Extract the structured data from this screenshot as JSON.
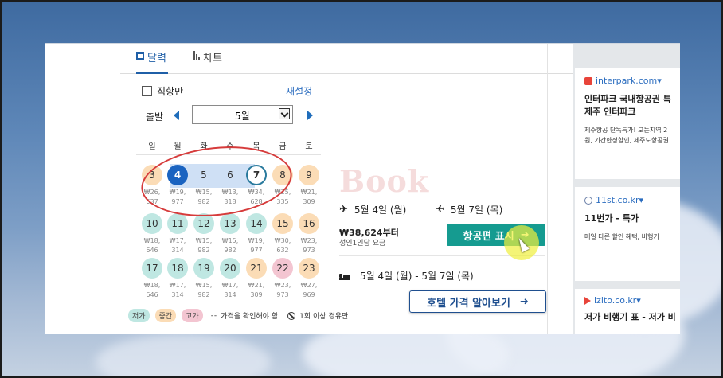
{
  "tabs": [
    {
      "label": "달력",
      "icon": "calendar-icon",
      "active": true
    },
    {
      "label": "차트",
      "icon": "bar-chart-icon",
      "active": false
    }
  ],
  "filters": {
    "direct_only_label": "직항만",
    "direct_only_checked": false,
    "reset_label": "재설정"
  },
  "departure": {
    "label": "출발",
    "month": "5월"
  },
  "weekdays": [
    "일",
    "월",
    "화",
    "수",
    "목",
    "금",
    "토"
  ],
  "calendar_weeks": [
    [
      {
        "day": "3",
        "price": "₩26,637",
        "level": "mid"
      },
      {
        "day": "4",
        "price": "₩19,977",
        "level": "selected-start"
      },
      {
        "day": "5",
        "price": "₩15,982",
        "level": "in-range"
      },
      {
        "day": "6",
        "price": "₩13,318",
        "level": "in-range"
      },
      {
        "day": "7",
        "price": "₩34,628",
        "level": "selected-end"
      },
      {
        "day": "8",
        "price": "₩25,335",
        "level": "mid"
      },
      {
        "day": "9",
        "price": "₩21,309",
        "level": "mid"
      }
    ],
    [
      {
        "day": "10",
        "price": "₩18,646",
        "level": "low"
      },
      {
        "day": "11",
        "price": "₩17,314",
        "level": "low"
      },
      {
        "day": "12",
        "price": "₩15,982",
        "level": "low"
      },
      {
        "day": "13",
        "price": "₩15,982",
        "level": "low"
      },
      {
        "day": "14",
        "price": "₩19,977",
        "level": "low"
      },
      {
        "day": "15",
        "price": "₩30,632",
        "level": "mid"
      },
      {
        "day": "16",
        "price": "₩23,973",
        "level": "mid"
      }
    ],
    [
      {
        "day": "17",
        "price": "₩18,646",
        "level": "low"
      },
      {
        "day": "18",
        "price": "₩17,314",
        "level": "low"
      },
      {
        "day": "19",
        "price": "₩15,982",
        "level": "low"
      },
      {
        "day": "20",
        "price": "₩17,314",
        "level": "low"
      },
      {
        "day": "21",
        "price": "₩21,309",
        "level": "mid"
      },
      {
        "day": "22",
        "price": "₩23,973",
        "level": "high"
      },
      {
        "day": "23",
        "price": "₩27,969",
        "level": "mid"
      }
    ]
  ],
  "legend": {
    "low": "저가",
    "mid": "중간",
    "high": "고가",
    "unconfirmed": "가격을 확인해야 함",
    "stopover": "1회 이상 경유만"
  },
  "trip": {
    "outbound_date": "5월 4일 (월)",
    "return_date": "5월 7일 (목)",
    "price": "₩38,624부터",
    "price_note": "성인1인당 요금",
    "flight_button": "항공편 표시",
    "hotel_dates": "5월 4일 (월) - 5월 7일 (목)",
    "hotel_button": "호텔 가격 알아보기"
  },
  "watermark": "Book",
  "ads": [
    {
      "domain": "interpark.com▾",
      "title_lines": [
        "인터파크 국내항공권 특",
        "제주 인터파크"
      ],
      "desc_lines": [
        "제주항공 단독특가! 모든지역 2",
        "원, 기간한정할인, 제주도항공권"
      ]
    },
    {
      "domain": "11st.co.kr▾",
      "title_lines": [
        "11번가 - 특가"
      ],
      "desc_lines": [
        "매일 다른 할인 혜택, 비행기"
      ]
    },
    {
      "domain": "izito.co.kr▾",
      "title_lines": [
        "저가 비행기 표 - 저가 비"
      ],
      "desc_lines": [
        "",
        ""
      ]
    }
  ],
  "colors": {
    "low": "#bfe7e2",
    "mid": "#fbdcb6",
    "high": "#f3c5d1",
    "selected": "#1a63c0",
    "range": "#cfe0f5",
    "flight_button": "#159b90",
    "link": "#2a6cbf"
  }
}
